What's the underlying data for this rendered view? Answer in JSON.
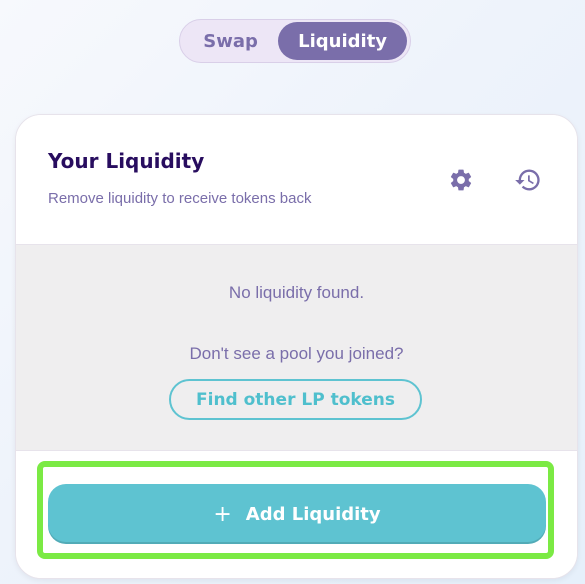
{
  "tabs": [
    {
      "label": "Swap",
      "active": false
    },
    {
      "label": "Liquidity",
      "active": true
    }
  ],
  "card": {
    "title": "Your Liquidity",
    "subtitle": "Remove liquidity to receive tokens back",
    "icons": [
      "gear-icon",
      "history-icon"
    ],
    "empty_message": "No liquidity found.",
    "prompt": "Don't see a pool you joined?",
    "find_button": "Find other LP tokens",
    "add_button": "Add Liquidity",
    "add_icon": "+"
  },
  "colors": {
    "accent_purple": "#7a6eaa",
    "title_dark": "#280d5f",
    "teal": "#5ec3d1",
    "highlight_green": "#7bea44"
  }
}
